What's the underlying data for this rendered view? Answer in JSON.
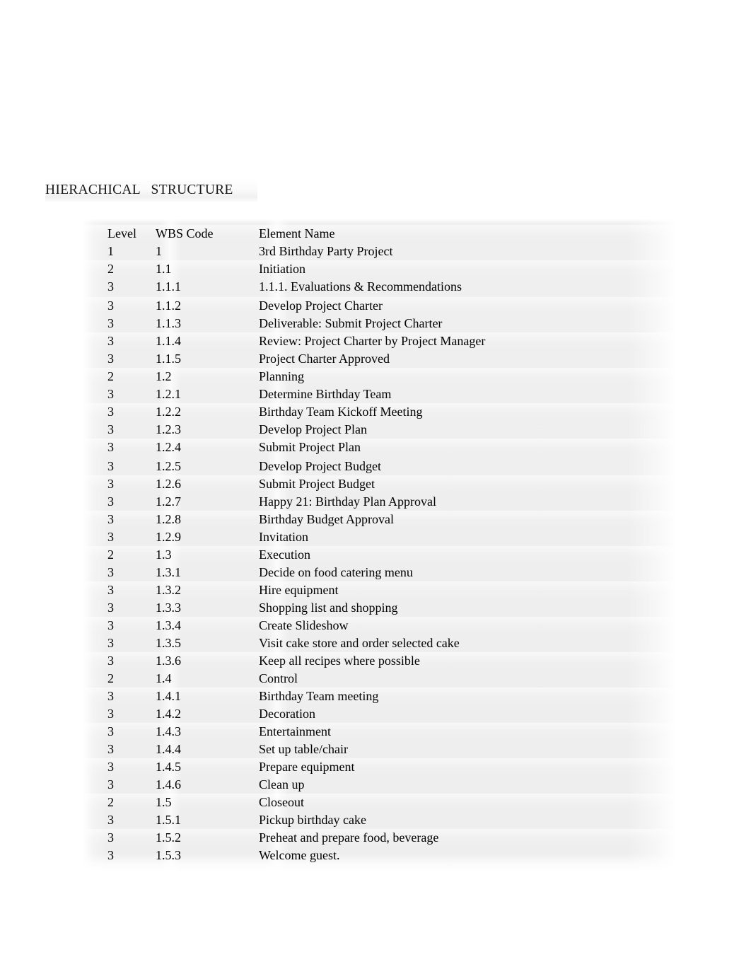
{
  "document": {
    "title": "HIERACHICAL   STRUCTURE"
  },
  "table": {
    "columns": {
      "level": "Level",
      "wbs_code": "WBS Code",
      "element_name": "Element Name"
    },
    "rows": [
      {
        "level": "1",
        "wbs": "1",
        "name": "3rd Birthday Party Project"
      },
      {
        "level": "2",
        "wbs": "1.1",
        "name": "Initiation"
      },
      {
        "level": "3",
        "wbs": "1.1.1",
        "name": "1.1.1. Evaluations & Recommendations"
      },
      {
        "level": "3",
        "wbs": "1.1.2",
        "name": "Develop Project Charter"
      },
      {
        "level": "3",
        "wbs": "1.1.3",
        "name": "Deliverable: Submit Project Charter"
      },
      {
        "level": "3",
        "wbs": "1.1.4",
        "name": "Review: Project Charter by Project Manager"
      },
      {
        "level": "3",
        "wbs": "1.1.5",
        "name": "Project Charter Approved"
      },
      {
        "level": "2",
        "wbs": "1.2",
        "name": "Planning"
      },
      {
        "level": "3",
        "wbs": "1.2.1",
        "name": "Determine Birthday Team"
      },
      {
        "level": "3",
        "wbs": "1.2.2",
        "name": "Birthday Team Kickoff Meeting"
      },
      {
        "level": "3",
        "wbs": "1.2.3",
        "name": "Develop Project Plan"
      },
      {
        "level": "3",
        "wbs": "1.2.4",
        "name": "Submit Project Plan"
      },
      {
        "level": "3",
        "wbs": "1.2.5",
        "name": "Develop Project Budget"
      },
      {
        "level": "3",
        "wbs": "1.2.6",
        "name": "Submit Project Budget"
      },
      {
        "level": "3",
        "wbs": "1.2.7",
        "name": "Happy 21: Birthday Plan Approval"
      },
      {
        "level": "3",
        "wbs": "1.2.8",
        "name": "Birthday Budget Approval"
      },
      {
        "level": "3",
        "wbs": "1.2.9",
        "name": "Invitation"
      },
      {
        "level": "2",
        "wbs": "1.3",
        "name": "Execution"
      },
      {
        "level": "3",
        "wbs": "1.3.1",
        "name": "Decide on food catering menu"
      },
      {
        "level": "3",
        "wbs": "1.3.2",
        "name": "Hire equipment"
      },
      {
        "level": "3",
        "wbs": "1.3.3",
        "name": "Shopping list and shopping"
      },
      {
        "level": "3",
        "wbs": "1.3.4",
        "name": "Create Slideshow"
      },
      {
        "level": "3",
        "wbs": "1.3.5",
        "name": "Visit cake store and order selected cake"
      },
      {
        "level": "3",
        "wbs": "1.3.6",
        "name": "Keep all recipes where possible"
      },
      {
        "level": "2",
        "wbs": "1.4",
        "name": "Control"
      },
      {
        "level": "3",
        "wbs": "1.4.1",
        "name": "Birthday Team meeting"
      },
      {
        "level": "3",
        "wbs": "1.4.2",
        "name": "Decoration"
      },
      {
        "level": "3",
        "wbs": "1.4.3",
        "name": "Entertainment"
      },
      {
        "level": "3",
        "wbs": "1.4.4",
        "name": "Set up table/chair"
      },
      {
        "level": "3",
        "wbs": "1.4.5",
        "name": "Prepare equipment"
      },
      {
        "level": "3",
        "wbs": "1.4.6",
        "name": "Clean up"
      },
      {
        "level": "2",
        "wbs": "1.5",
        "name": "Closeout"
      },
      {
        "level": "3",
        "wbs": "1.5.1",
        "name": "Pickup birthday cake"
      },
      {
        "level": "3",
        "wbs": "1.5.2",
        "name": "Preheat and prepare food, beverage"
      },
      {
        "level": "3",
        "wbs": "1.5.3",
        "name": "Welcome guest."
      }
    ]
  }
}
